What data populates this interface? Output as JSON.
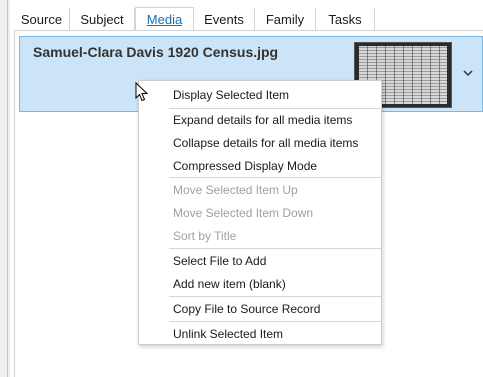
{
  "tabs": [
    {
      "label": "Source"
    },
    {
      "label": "Subject"
    },
    {
      "label": "Media"
    },
    {
      "label": "Events"
    },
    {
      "label": "Family"
    },
    {
      "label": "Tasks"
    }
  ],
  "active_tab": "Media",
  "media": {
    "item_title": "Samuel-Clara Davis 1920 Census.jpg",
    "thumbnail_icon": "census-image-thumbnail",
    "expand_icon": "chevron-down-icon"
  },
  "context_menu": {
    "items": [
      {
        "label": "Display Selected Item",
        "enabled": true
      },
      {
        "label": "Expand details for all media items",
        "enabled": true
      },
      {
        "label": "Collapse details for all media items",
        "enabled": true
      },
      {
        "label": "Compressed Display Mode",
        "enabled": true
      },
      {
        "label": "Move Selected Item Up",
        "enabled": false
      },
      {
        "label": "Move Selected Item Down",
        "enabled": false
      },
      {
        "label": "Sort by Title",
        "enabled": false
      },
      {
        "label": "Select File to Add",
        "enabled": true
      },
      {
        "label": "Add new item (blank)",
        "enabled": true
      },
      {
        "label": "Copy File to Source Record",
        "enabled": true
      },
      {
        "label": "Unlink Selected Item",
        "enabled": true
      }
    ]
  },
  "colors": {
    "selection_bg": "#cce4f7",
    "selection_border": "#7fb6e3",
    "active_tab_text": "#1a6fb3",
    "disabled_text": "#a0a0a0"
  }
}
